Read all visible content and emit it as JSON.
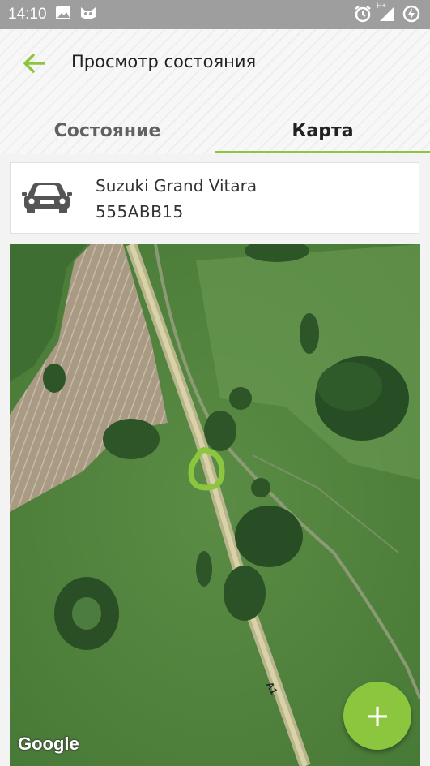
{
  "status_bar": {
    "time": "14:10",
    "network": "H+"
  },
  "header": {
    "title": "Просмотр состояния"
  },
  "tabs": [
    {
      "label": "Состояние",
      "selected": false
    },
    {
      "label": "Карта",
      "selected": true
    }
  ],
  "vehicle": {
    "name": "Suzuki Grand Vitara",
    "plate": "555ABB15"
  },
  "map": {
    "attribution": "Google",
    "road_label": "A1"
  },
  "fab": {
    "label": "+"
  },
  "colors": {
    "accent": "#8cc63f",
    "status_bar": "#9e9e9e"
  },
  "icons": {
    "back": "arrow-left-icon",
    "vehicle": "car-icon",
    "location": "location-pin-icon",
    "add": "plus-icon"
  }
}
